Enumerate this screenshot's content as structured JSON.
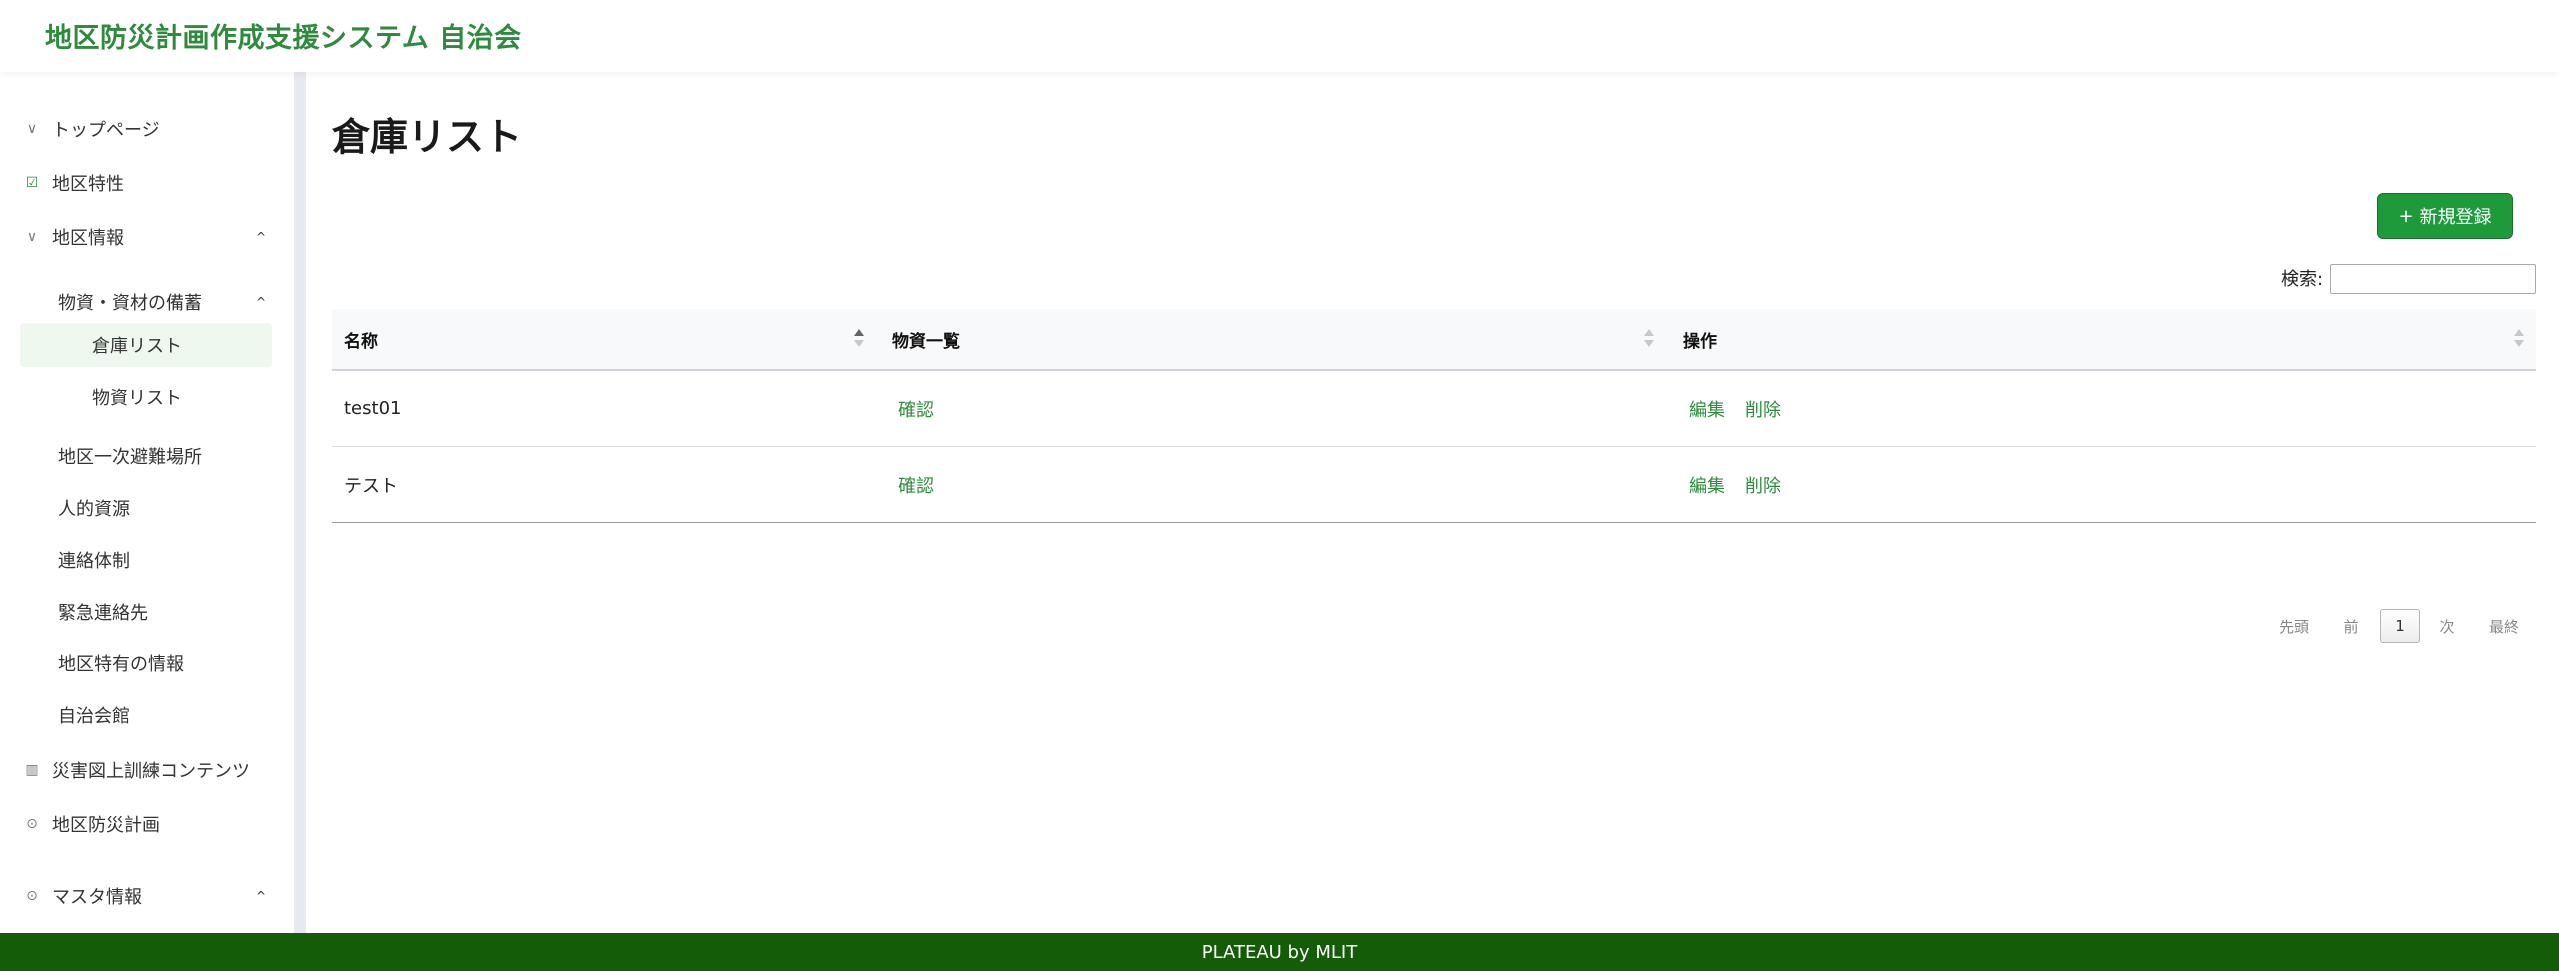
{
  "header": {
    "app_title": "地区防災計画作成支援システム 自治会"
  },
  "sidebar": {
    "items": [
      {
        "label": "トップページ",
        "icon": "chevron-down-icon"
      },
      {
        "label": "地区特性",
        "icon": "edit-icon"
      },
      {
        "label": "地区情報",
        "icon": "chevron-down-icon",
        "caret": "^"
      },
      {
        "label": "物資・資材の備蓄",
        "caret": "^"
      },
      {
        "label": "倉庫リスト",
        "selected": true
      },
      {
        "label": "物資リスト"
      },
      {
        "label": "地区一次避難場所"
      },
      {
        "label": "人的資源"
      },
      {
        "label": "連絡体制"
      },
      {
        "label": "緊急連絡先"
      },
      {
        "label": "地区特有の情報"
      },
      {
        "label": "自治会館"
      },
      {
        "label": "災害図上訓練コンテンツ",
        "icon": "map-icon"
      },
      {
        "label": "地区防災計画",
        "icon": "circle-icon"
      },
      {
        "label": "マスタ情報",
        "icon": "circle-icon",
        "caret": "^"
      }
    ],
    "icons": {
      "chevron": "∨",
      "edit": "☑",
      "map": "▥",
      "circle": "⊙",
      "caret": "^"
    }
  },
  "main": {
    "page_title": "倉庫リスト",
    "new_button": {
      "icon": "+",
      "label": "新規登録"
    },
    "search": {
      "label": "検索:",
      "value": ""
    },
    "table": {
      "columns": [
        "名称",
        "物資一覧",
        "操作"
      ],
      "rows": [
        {
          "name": "test01",
          "items_link": "確認",
          "edit": "編集",
          "delete": "削除"
        },
        {
          "name": "テスト",
          "items_link": "確認",
          "edit": "編集",
          "delete": "削除"
        }
      ]
    },
    "pagination": {
      "first": "先頭",
      "prev": "前",
      "current": "1",
      "next": "次",
      "last": "最終"
    }
  },
  "footer": {
    "text": "PLATEAU by MLIT"
  },
  "colors": {
    "brand_green": "#2e8b3d",
    "button_green": "#1f9a3a",
    "footer_green": "#145c08",
    "selected_bg": "#eef8ee"
  }
}
